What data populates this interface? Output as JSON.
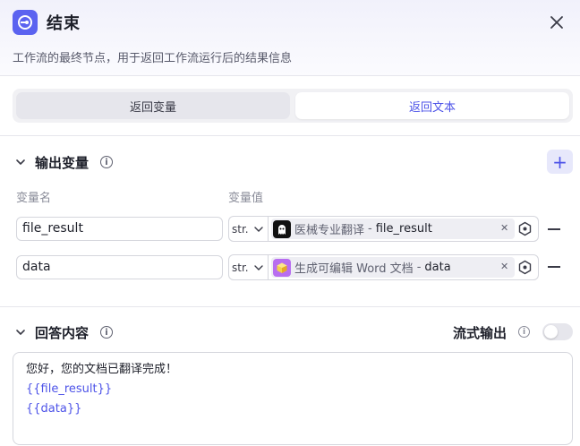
{
  "header": {
    "title": "结束",
    "description": "工作流的最终节点，用于返回工作流运行后的结果信息"
  },
  "tabs": [
    {
      "label": "返回变量",
      "active": false
    },
    {
      "label": "返回文本",
      "active": true
    }
  ],
  "output_section": {
    "title": "输出变量",
    "col_name": "变量名",
    "col_value": "变量值",
    "rows": [
      {
        "name": "file_result",
        "type": "str.",
        "source_node": "医械专业翻译",
        "separator": "-",
        "source_field": "file_result",
        "avatar_icon": "ghost-avatar-icon"
      },
      {
        "name": "data",
        "type": "str.",
        "source_node": "生成可编辑 Word 文档",
        "separator": "-",
        "source_field": "data",
        "avatar_icon": "cube-avatar-icon"
      }
    ]
  },
  "answer_section": {
    "title": "回答内容",
    "stream_label": "流式输出",
    "stream_enabled": false,
    "lines": [
      "您好，您的文档已翻译完成！",
      "{{file_result}}",
      "{{data}}"
    ]
  },
  "colors": {
    "accent": "#4d53e8",
    "node_icon": "#5b63f0",
    "cube_avatar": "#b86ef0"
  }
}
